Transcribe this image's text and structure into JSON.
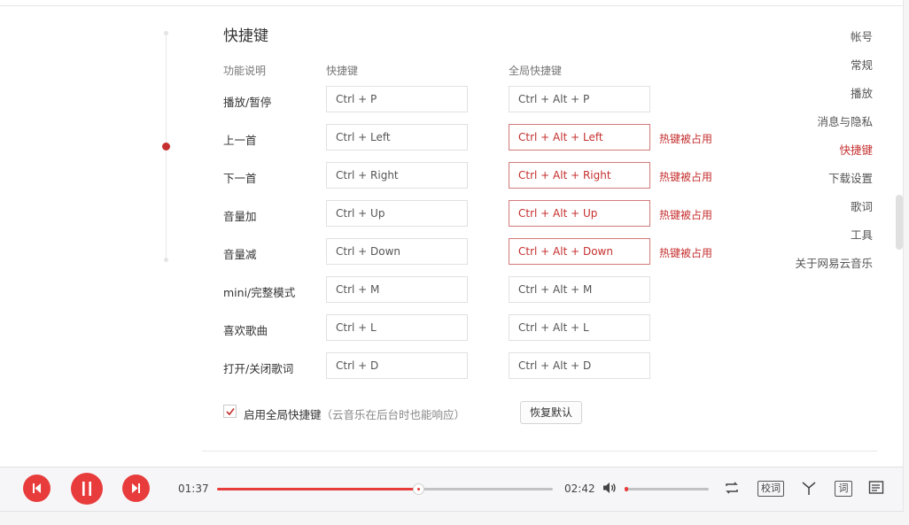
{
  "nav": {
    "items": [
      {
        "label": "帐号",
        "active": false
      },
      {
        "label": "常规",
        "active": false
      },
      {
        "label": "播放",
        "active": false
      },
      {
        "label": "消息与隐私",
        "active": false
      },
      {
        "label": "快捷键",
        "active": true
      },
      {
        "label": "下载设置",
        "active": false
      },
      {
        "label": "歌词",
        "active": false
      },
      {
        "label": "工具",
        "active": false
      },
      {
        "label": "关于网易云音乐",
        "active": false
      }
    ]
  },
  "shortcuts": {
    "title": "快捷键",
    "columns": {
      "function": "功能说明",
      "shortcut": "快捷键",
      "global": "全局快捷键"
    },
    "rows": [
      {
        "label": "播放/暂停",
        "shortcut": "Ctrl + P",
        "global": "Ctrl + Alt + P",
        "conflict": false,
        "note": ""
      },
      {
        "label": "上一首",
        "shortcut": "Ctrl + Left",
        "global": "Ctrl + Alt + Left",
        "conflict": true,
        "note": "热键被占用"
      },
      {
        "label": "下一首",
        "shortcut": "Ctrl + Right",
        "global": "Ctrl + Alt + Right",
        "conflict": true,
        "note": "热键被占用"
      },
      {
        "label": "音量加",
        "shortcut": "Ctrl + Up",
        "global": "Ctrl + Alt + Up",
        "conflict": true,
        "note": "热键被占用"
      },
      {
        "label": "音量减",
        "shortcut": "Ctrl + Down",
        "global": "Ctrl + Alt + Down",
        "conflict": true,
        "note": "热键被占用"
      },
      {
        "label": "mini/完整模式",
        "shortcut": "Ctrl + M",
        "global": "Ctrl + Alt + M",
        "conflict": false,
        "note": ""
      },
      {
        "label": "喜欢歌曲",
        "shortcut": "Ctrl + L",
        "global": "Ctrl + Alt + L",
        "conflict": false,
        "note": ""
      },
      {
        "label": "打开/关闭歌词",
        "shortcut": "Ctrl + D",
        "global": "Ctrl + Alt + D",
        "conflict": false,
        "note": ""
      }
    ],
    "enable_global": {
      "checked": true,
      "label": "启用全局快捷键",
      "hint": "（云音乐在后台时也能响应）"
    },
    "restore_label": "恢复默认"
  },
  "player": {
    "current_time": "01:37",
    "total_time": "02:42",
    "progress": 0.6,
    "volume": 0.02,
    "lyric_calibrate_label": "校词",
    "lyric_toggle_label": "词"
  },
  "colors": {
    "accent": "#c62f2f",
    "player_red": "#e83c3c"
  },
  "icons": {
    "prev": "skip-previous-icon",
    "pause": "pause-icon",
    "next": "skip-next-icon",
    "volume": "speaker-icon",
    "repeat": "repeat-icon",
    "share": "share-icon",
    "playlist": "playlist-icon"
  }
}
